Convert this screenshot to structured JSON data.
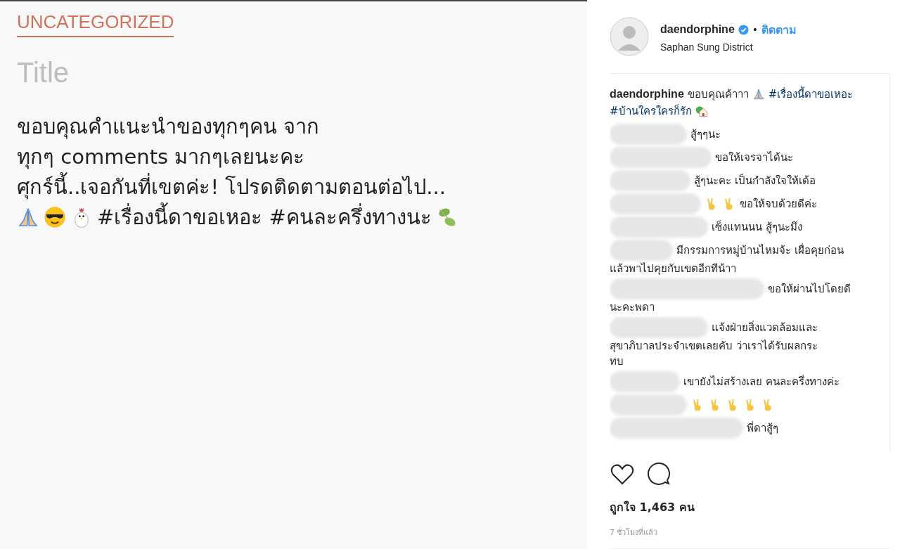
{
  "post": {
    "category": "UNCATEGORIZED",
    "title": {
      "placeholder": "Title"
    },
    "body_lines": [
      [
        {
          "kind": "text",
          "text": "ขอบคุณคำแนะนำของทุกๆคน จาก"
        }
      ],
      [
        {
          "kind": "text",
          "text": "ทุกๆ comments มากๆเลยนะคะ"
        }
      ],
      [
        {
          "kind": "text",
          "text": "ศุกร์นี้..เจอกันที่เขตค่ะ! โปรดติดตามตอนต่อไป..."
        }
      ],
      [
        {
          "kind": "pray"
        },
        {
          "kind": "cool"
        },
        {
          "kind": "chicken"
        },
        {
          "kind": "text",
          "text": "#เรื่องนี้ดาขอเหอะ #คนละครึ่งทางนะ"
        },
        {
          "kind": "leaf"
        }
      ]
    ]
  },
  "header": {
    "username": "daendorphine",
    "verified": true,
    "separator": "•",
    "follow": "ติดตาม",
    "location": "Saphan Sung District"
  },
  "caption": [
    {
      "kind": "user",
      "text": "daendorphine"
    },
    {
      "kind": "text",
      "text": "ขอบคุณค้าาา"
    },
    {
      "kind": "pray"
    },
    {
      "kind": "tag",
      "text": "#เรื่องนี้ดาขอเหอะ"
    },
    {
      "kind": "tag",
      "text": "#บ้านใครใครก็รัก"
    },
    {
      "kind": "house"
    }
  ],
  "comments": [
    {
      "text": "สู้ๆๆนะ"
    },
    {
      "text": "ขอให้เจรจาได้นะ"
    },
    {
      "text": "สู้ๆนะคะ เป็นกำลังใจให้เด้อ"
    },
    {
      "emoji": [
        {
          "kind": "peace"
        },
        {
          "kind": "peace"
        }
      ],
      "text": "ขอให้จบด้วยดีค่ะ"
    },
    {
      "text": "เซ็งแทนนน สู้ๆนะมึง"
    },
    {
      "text": "มีกรรมการหมู่บ้านไหมจ้ะ เผื่อคุยก่อน",
      "more": [
        "แล้วพาไปคุยกับเขตอีกทีน้าา"
      ]
    },
    {
      "text": "ขอให้ผ่านไปโดยดี",
      "more": [
        "นะคะพดา"
      ]
    },
    {
      "text": "แจ้งฝ่ายสิ่งแวดล้อมและ",
      "more": [
        "สุขาภิบาลประจำเขตเลยคับ ว่าเราได้รับผลกระ",
        "ทบ"
      ]
    },
    {
      "text": "เขายังไม่สร้างเลย คนละครึ่งทางค่ะ"
    },
    {
      "emoji": [
        {
          "kind": "peace"
        },
        {
          "kind": "peace"
        },
        {
          "kind": "peace"
        },
        {
          "kind": "peace"
        },
        {
          "kind": "peace"
        }
      ]
    },
    {
      "text": "พี่ดาสู้ๆ"
    }
  ],
  "likes": "ถูกใจ 1,463 คน",
  "time": "7 ชั่วโมงที่แล้ว"
}
